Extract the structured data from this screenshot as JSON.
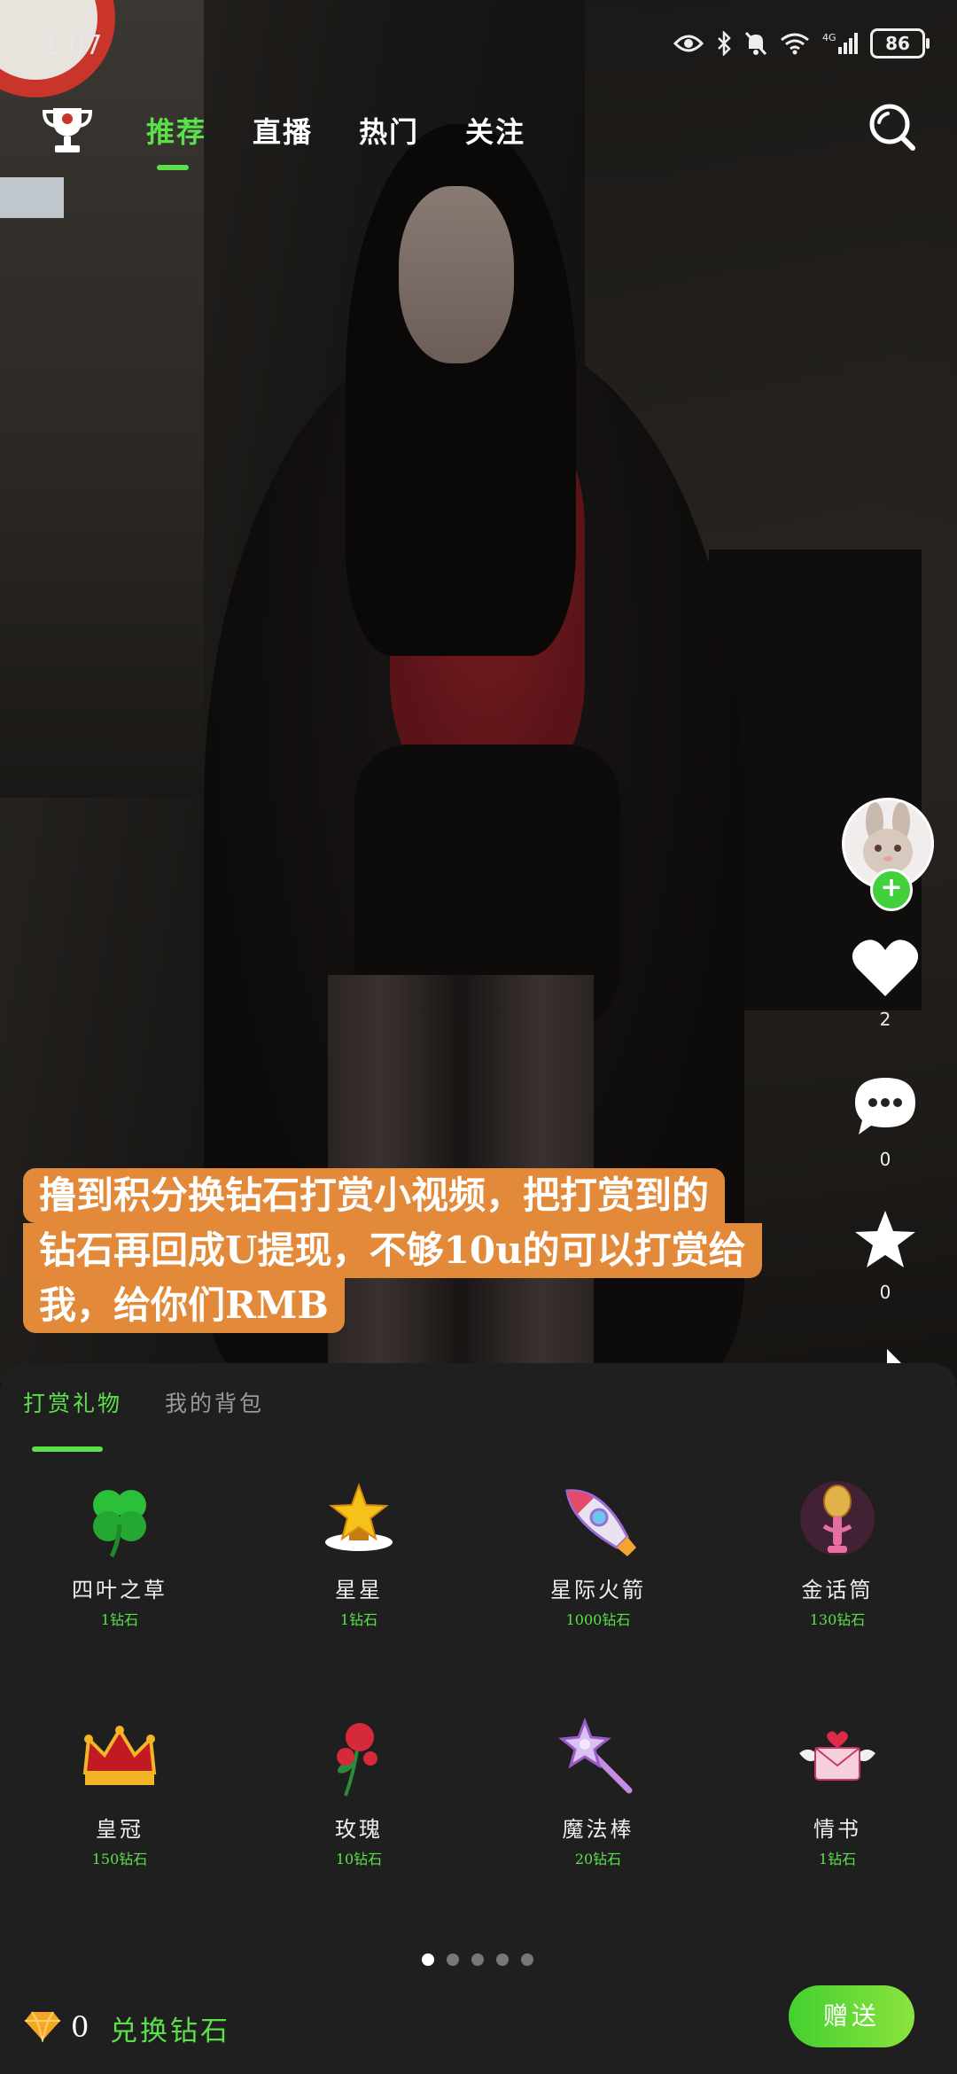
{
  "status_bar": {
    "time": "1:07",
    "battery": "86",
    "network": "4G"
  },
  "top_nav": {
    "tabs": [
      {
        "label": "推荐",
        "active": true
      },
      {
        "label": "直播",
        "active": false
      },
      {
        "label": "热门",
        "active": false
      },
      {
        "label": "关注",
        "active": false
      }
    ],
    "left_icon": "trophy-icon",
    "right_icon": "search-icon"
  },
  "actions": {
    "like_count": "2",
    "comment_count": "0",
    "favorite_count": "0"
  },
  "caption": {
    "line1": "撸到积分换钻石打赏小视频，把打赏到的",
    "line2": "钻石再回成U提现，不够10u的可以打赏给",
    "line3": "我，给你们RMB"
  },
  "gift_panel": {
    "tabs": [
      {
        "label": "打赏礼物",
        "active": true
      },
      {
        "label": "我的背包",
        "active": false
      }
    ],
    "gifts": [
      {
        "name": "四叶之草",
        "price": "1钻石",
        "icon": "clover-icon"
      },
      {
        "name": "星星",
        "price": "1钻石",
        "icon": "star-trophy-icon"
      },
      {
        "name": "星际火箭",
        "price": "1000钻石",
        "icon": "rocket-icon"
      },
      {
        "name": "金话筒",
        "price": "130钻石",
        "icon": "microphone-icon"
      },
      {
        "name": "皇冠",
        "price": "150钻石",
        "icon": "crown-icon"
      },
      {
        "name": "玫瑰",
        "price": "10钻石",
        "icon": "rose-icon"
      },
      {
        "name": "魔法棒",
        "price": "20钻石",
        "icon": "magic-wand-icon"
      },
      {
        "name": "情书",
        "price": "1钻石",
        "icon": "love-letter-icon"
      }
    ],
    "page_count": 5,
    "current_page": 1,
    "balance": "0",
    "exchange_label": "兑换钻石",
    "send_label": "赠送"
  },
  "colors": {
    "accent": "#5be04a",
    "caption_bg": "#e2893a",
    "panel_bg": "#1f1f1f"
  }
}
